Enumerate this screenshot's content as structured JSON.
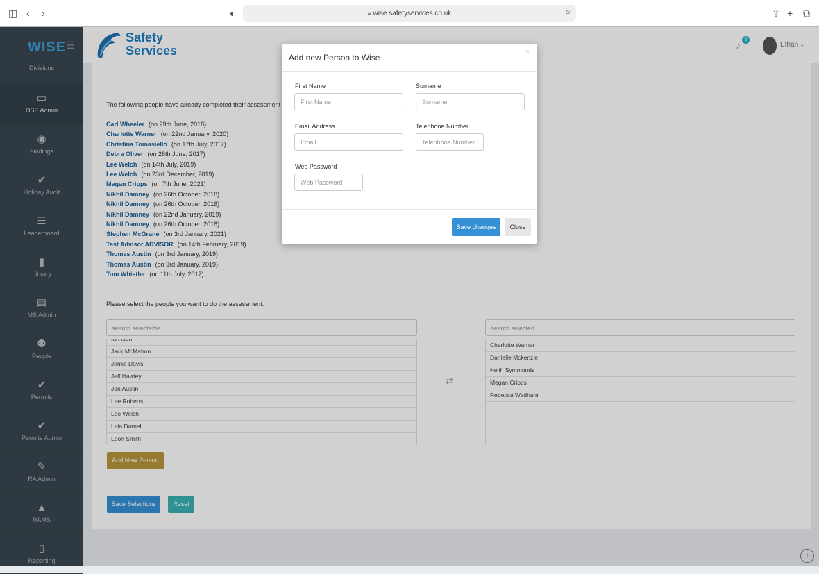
{
  "browser": {
    "url": "wise.safetyservices.co.uk",
    "sidebar_icon": "sidebar-toggle-icon",
    "back_icon": "back-icon",
    "forward_icon": "forward-icon"
  },
  "header": {
    "logo": "WISE",
    "brand_line1": "Safety",
    "brand_line2": "Services",
    "notification_count": "0",
    "user_name": "Ethan"
  },
  "sidebar": {
    "top_label": "Divisions",
    "items": [
      {
        "label": "DSE Admin",
        "icon": "monitor-icon",
        "glyph": "▭"
      },
      {
        "label": "Findings",
        "icon": "eye-icon",
        "glyph": "◉"
      },
      {
        "label": "Holiday Audit",
        "icon": "check-icon",
        "glyph": "✔"
      },
      {
        "label": "Leaderboard",
        "icon": "list-icon",
        "glyph": "☰"
      },
      {
        "label": "Library",
        "icon": "book-icon",
        "glyph": "▮"
      },
      {
        "label": "MS Admin",
        "icon": "table-icon",
        "glyph": "▤"
      },
      {
        "label": "People",
        "icon": "people-icon",
        "glyph": "⚉"
      },
      {
        "label": "Permits",
        "icon": "check-icon",
        "glyph": "✔"
      },
      {
        "label": "Permits Admin",
        "icon": "check-icon",
        "glyph": "✔"
      },
      {
        "label": "RA Admin",
        "icon": "pencil-icon",
        "glyph": "✎"
      },
      {
        "label": "RAMS",
        "icon": "warning-icon",
        "glyph": "▲"
      },
      {
        "label": "Reporting",
        "icon": "file-icon",
        "glyph": "▯"
      }
    ]
  },
  "main": {
    "completed_intro": "The following people have already completed their assessment",
    "completed": [
      {
        "name": "Carl Wheeler",
        "date": "(on 29th June, 2018)"
      },
      {
        "name": "Charlotte Warner",
        "date": "(on 22nd January, 2020)"
      },
      {
        "name": "Christina Tomasiello",
        "date": "(on 17th July, 2017)"
      },
      {
        "name": "Debra Oliver",
        "date": "(on 28th June, 2017)"
      },
      {
        "name": "Lee Welch",
        "date": "(on 14th July, 2019)"
      },
      {
        "name": "Lee Welch",
        "date": "(on 23rd December, 2019)"
      },
      {
        "name": "Megan Cripps",
        "date": "(on 7th June, 2021)"
      },
      {
        "name": "Nikhil Damney",
        "date": "(on 26th October, 2018)"
      },
      {
        "name": "Nikhil Damney",
        "date": "(on 26th October, 2018)"
      },
      {
        "name": "Nikhil Damney",
        "date": "(on 22nd January, 2019)"
      },
      {
        "name": "Nikhil Damney",
        "date": "(on 26th October, 2018)"
      },
      {
        "name": "Stephen McGrane",
        "date": "(on 3rd January, 2021)"
      },
      {
        "name": "Test Advisor ADVISOR",
        "date": "(on 14th February, 2019)"
      },
      {
        "name": "Thomas Austin",
        "date": "(on 3rd January, 2019)"
      },
      {
        "name": "Thomas Austin",
        "date": "(on 3rd January, 2019)"
      },
      {
        "name": "Tom Whistler",
        "date": "(on 11th July, 2017)"
      }
    ],
    "select_intro": "Please select the people you want to do the assessment.",
    "search_selectable_placeholder": "search selectable",
    "search_selected_placeholder": "search selected",
    "selectable": [
      "Ian Ison",
      "Jack McMahon",
      "Jamie Davis",
      "Jeff Hawley",
      "Jon Austin",
      "Lee Roberts",
      "Lee Welch",
      "Leia Darnell",
      "Leon Smith"
    ],
    "selected": [
      "Charlotte Warner",
      "Danielle Mckenzie",
      "Keith Symmonds",
      "Megan Cripps",
      "Rebecca Wadham"
    ],
    "add_person_label": "Add New Person",
    "save_selections_label": "Save Selections",
    "reset_label": "Reset"
  },
  "modal": {
    "title": "Add new Person to Wise",
    "first_name_label": "First Name",
    "first_name_placeholder": "First Name",
    "surname_label": "Surname",
    "surname_placeholder": "Surname",
    "email_label": "Email Address",
    "email_placeholder": "Email",
    "telephone_label": "Telephone Number",
    "telephone_placeholder": "Telephone Number",
    "password_label": "Web Password",
    "password_placeholder": "Web Password",
    "save_label": "Save changes",
    "close_label": "Close"
  },
  "colors": {
    "sidebar": "#3a4651",
    "primary_button": "#3590d6",
    "add_person_button": "#b8953a",
    "reset_button": "#3ab3b3",
    "name_link": "#1a5e94"
  }
}
